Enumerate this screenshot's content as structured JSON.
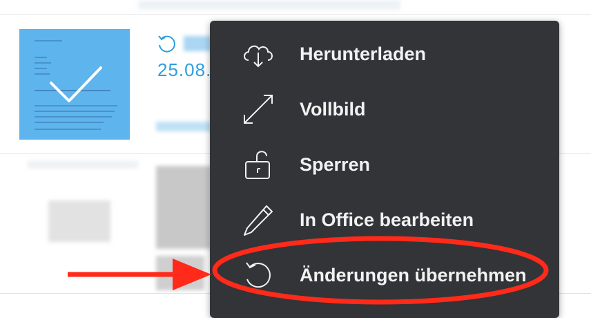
{
  "file_row": {
    "date_partial": "25.08."
  },
  "context_menu": {
    "items": [
      {
        "label": "Herunterladen",
        "icon": "cloud-download-icon"
      },
      {
        "label": "Vollbild",
        "icon": "expand-arrows-icon"
      },
      {
        "label": "Sperren",
        "icon": "unlock-icon"
      },
      {
        "label": "In Office bearbeiten",
        "icon": "pencil-icon"
      },
      {
        "label": "Änderungen übernehmen",
        "icon": "restore-icon"
      }
    ]
  },
  "colors": {
    "menu_bg": "#333437",
    "menu_text": "#f2f2f2",
    "accent_blue": "#2f9fdc",
    "annotation_red": "#ff2a1a"
  }
}
